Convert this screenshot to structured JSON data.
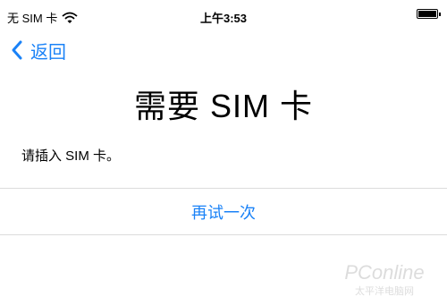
{
  "status_bar": {
    "carrier": "无 SIM 卡",
    "time": "上午3:53",
    "wifi_icon": "wifi-icon",
    "battery_icon": "battery-icon"
  },
  "nav": {
    "back_label": "返回",
    "back_icon": "chevron-left-icon"
  },
  "main": {
    "title": "需要 SIM 卡",
    "message": "请插入 SIM 卡。",
    "retry_label": "再试一次"
  },
  "watermark": {
    "brand": "PConline",
    "tagline": "太平洋电脑网"
  },
  "colors": {
    "accent": "#1a82f7",
    "divider": "#dcdcdc",
    "background": "#ffffff"
  }
}
